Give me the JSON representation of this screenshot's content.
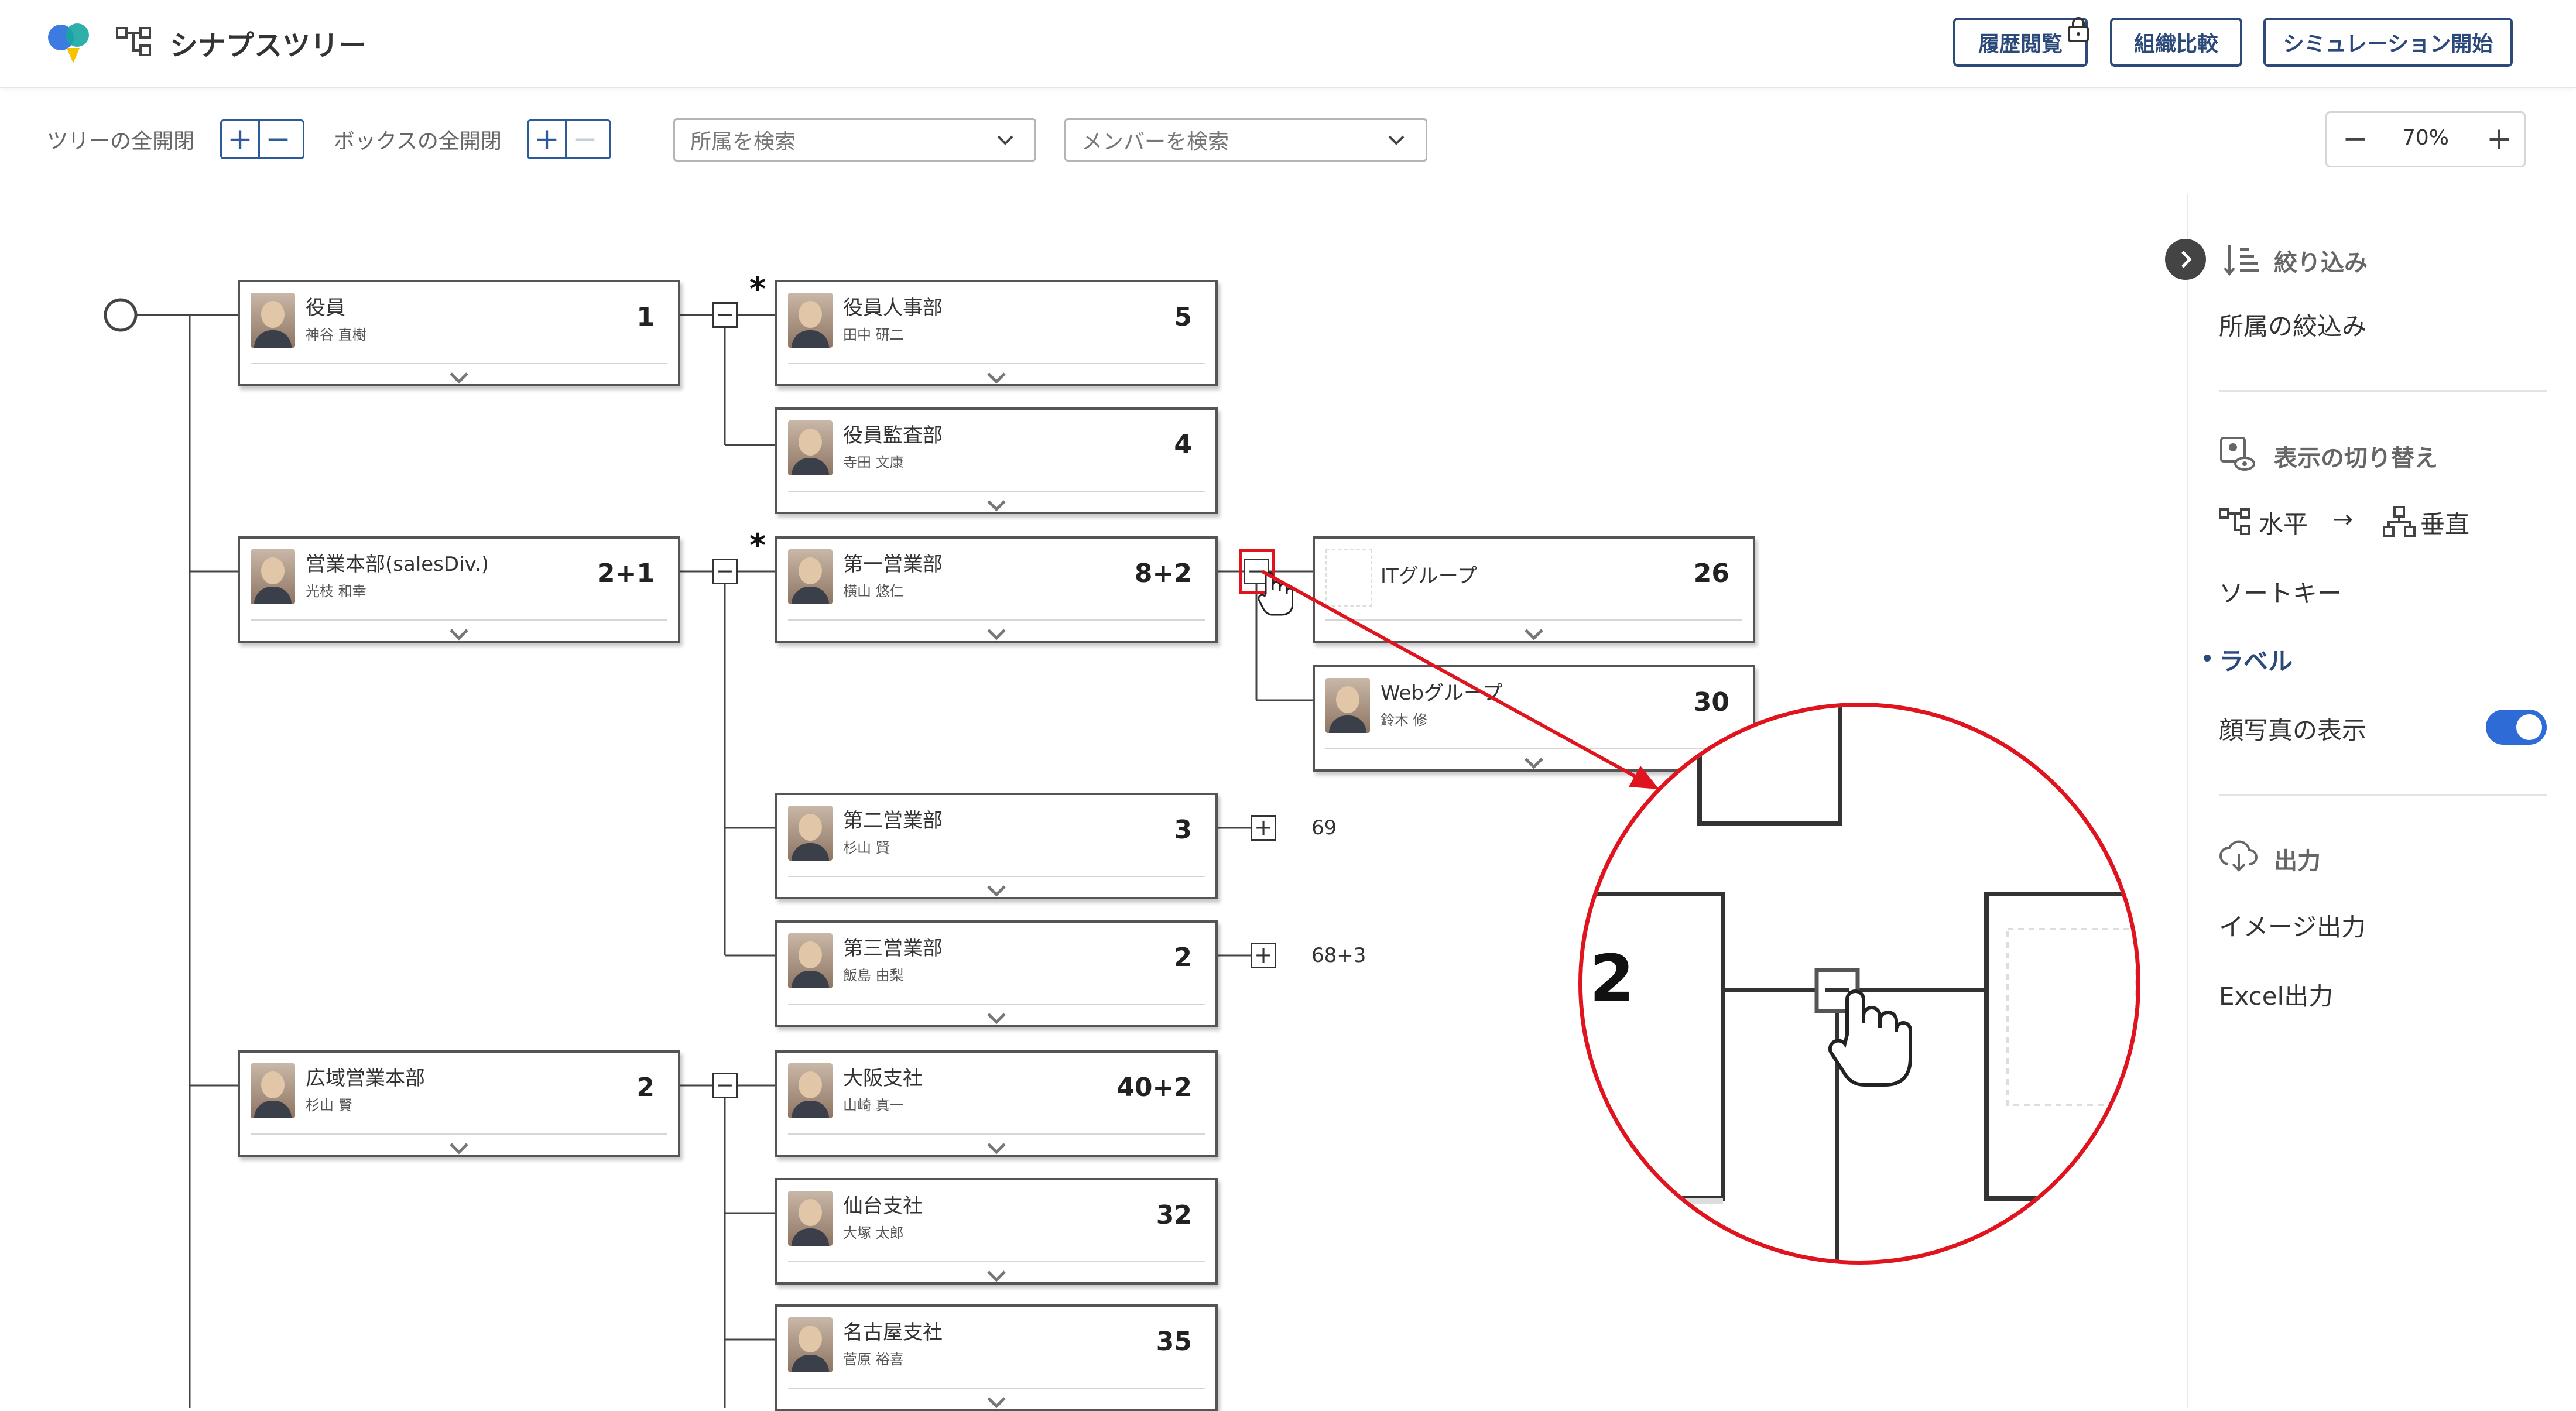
{
  "header": {
    "app_title": "シナプスツリー",
    "history_label": "履歴閲覧",
    "compare_label": "組織比較",
    "simulation_label": "シミュレーション開始"
  },
  "toolbar": {
    "tree_expand_label": "ツリーの全開閉",
    "box_expand_label": "ボックスの全開閉",
    "dept_search_placeholder": "所属を検索",
    "member_search_placeholder": "メンバーを検索",
    "zoom_value": "70%"
  },
  "tree": {
    "level1": [
      {
        "name": "役員",
        "person": "神谷 直樹",
        "count": "1"
      },
      {
        "name": "営業本部(salesDiv.)",
        "person": "光枝 和幸",
        "count": "2+1"
      },
      {
        "name": "広域営業本部",
        "person": "杉山 賢",
        "count": "2"
      }
    ],
    "level2": [
      {
        "name": "役員人事部",
        "person": "田中 研二",
        "count": "5"
      },
      {
        "name": "役員監査部",
        "person": "寺田 文康",
        "count": "4"
      },
      {
        "name": "第一営業部",
        "person": "横山 悠仁",
        "count": "8+2"
      },
      {
        "name": "第二営業部",
        "person": "杉山 賢",
        "count": "3",
        "sub_count": "69"
      },
      {
        "name": "第三営業部",
        "person": "飯島 由梨",
        "count": "2",
        "sub_count": "68+3"
      },
      {
        "name": "大阪支社",
        "person": "山崎 真一",
        "count": "40+2"
      },
      {
        "name": "仙台支社",
        "person": "大塚 太郎",
        "count": "32"
      },
      {
        "name": "名古屋支社",
        "person": "菅原 裕喜",
        "count": "35"
      }
    ],
    "level3": [
      {
        "name": "ITグループ",
        "person": "",
        "count": "26"
      },
      {
        "name": "Webグループ",
        "person": "鈴木 修",
        "count": "30"
      }
    ],
    "star": "*",
    "zoom_callout_count": "2"
  },
  "sidepanel": {
    "filter_heading": "絞り込み",
    "filter_dept": "所属の絞込み",
    "view_heading": "表示の切り替え",
    "horizontal_label": "水平",
    "arrow": "→",
    "vertical_label": "垂直",
    "sort_key": "ソートキー",
    "label_item": "ラベル",
    "photo_toggle_label": "顔写真の表示",
    "photo_toggle_on": true,
    "output_heading": "出力",
    "image_output": "イメージ出力",
    "excel_output": "Excel出力"
  },
  "colors": {
    "accent": "#2b4a7a",
    "toggle_blue": "#2f6bd6",
    "highlight_red": "#e0141e"
  }
}
